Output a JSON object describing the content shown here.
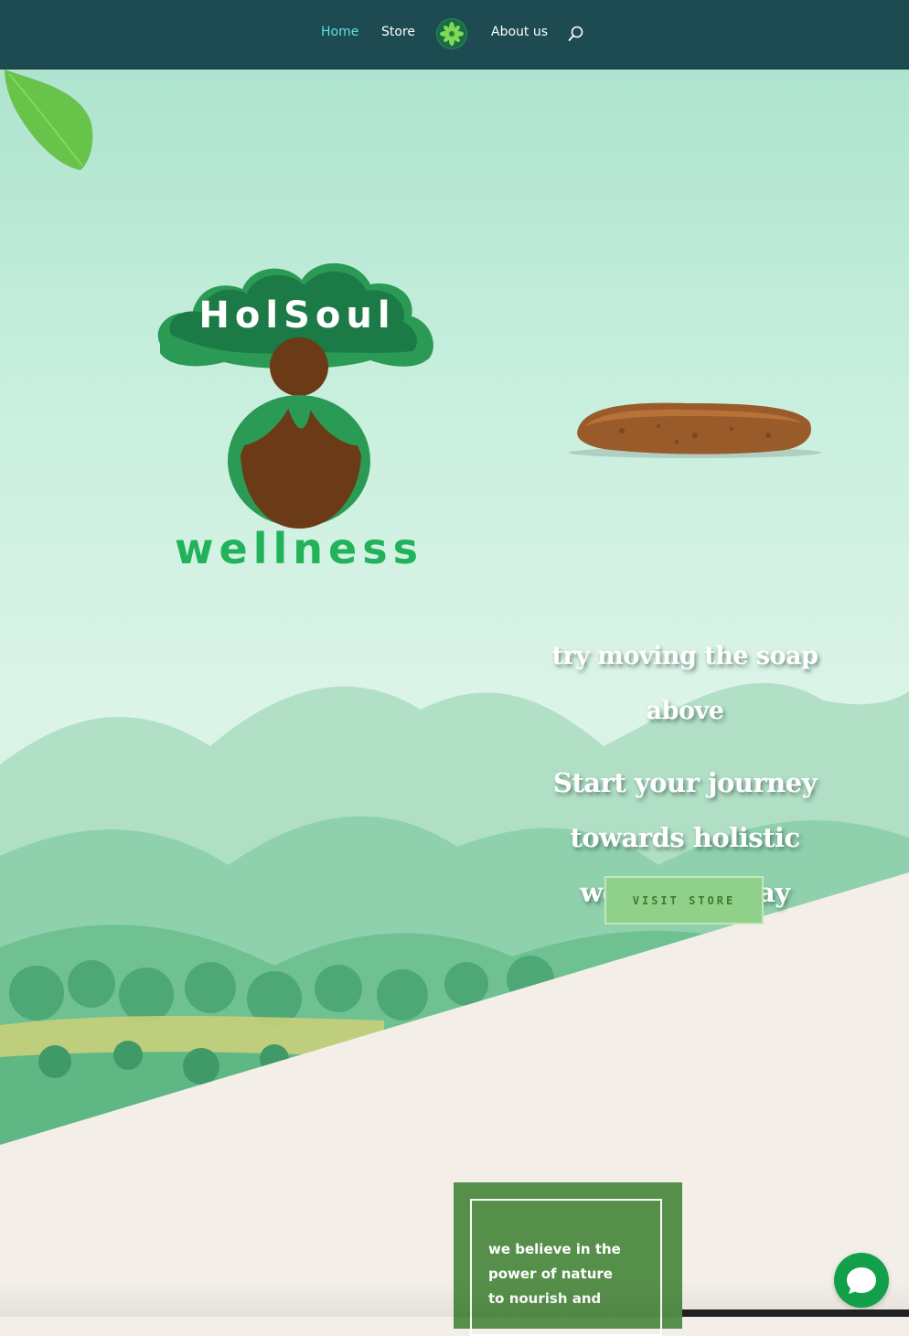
{
  "nav": {
    "items": [
      {
        "label": "Home",
        "active": true
      },
      {
        "label": "Store"
      },
      {
        "label": "About us"
      }
    ],
    "logo_icon": "leaf-flower-icon",
    "search_icon": "search-icon",
    "active_color": "#5ee3e0",
    "background": "#1e4a52"
  },
  "hero": {
    "logo": {
      "text_top": "HolSoul",
      "text_bottom": "wellness"
    },
    "soap_image": "soap-bar",
    "tagline_1": "try moving the soap above",
    "tagline_2": "Start your journey towards holistic wellness today",
    "button_label": "VISIT STORE",
    "button_color": "#8fd18a"
  },
  "about": {
    "text": "we believe in the power of nature to nourish and",
    "box_color": "#568f4a"
  },
  "chat": {
    "icon": "chat-bubble-icon",
    "color": "#12a04a"
  }
}
